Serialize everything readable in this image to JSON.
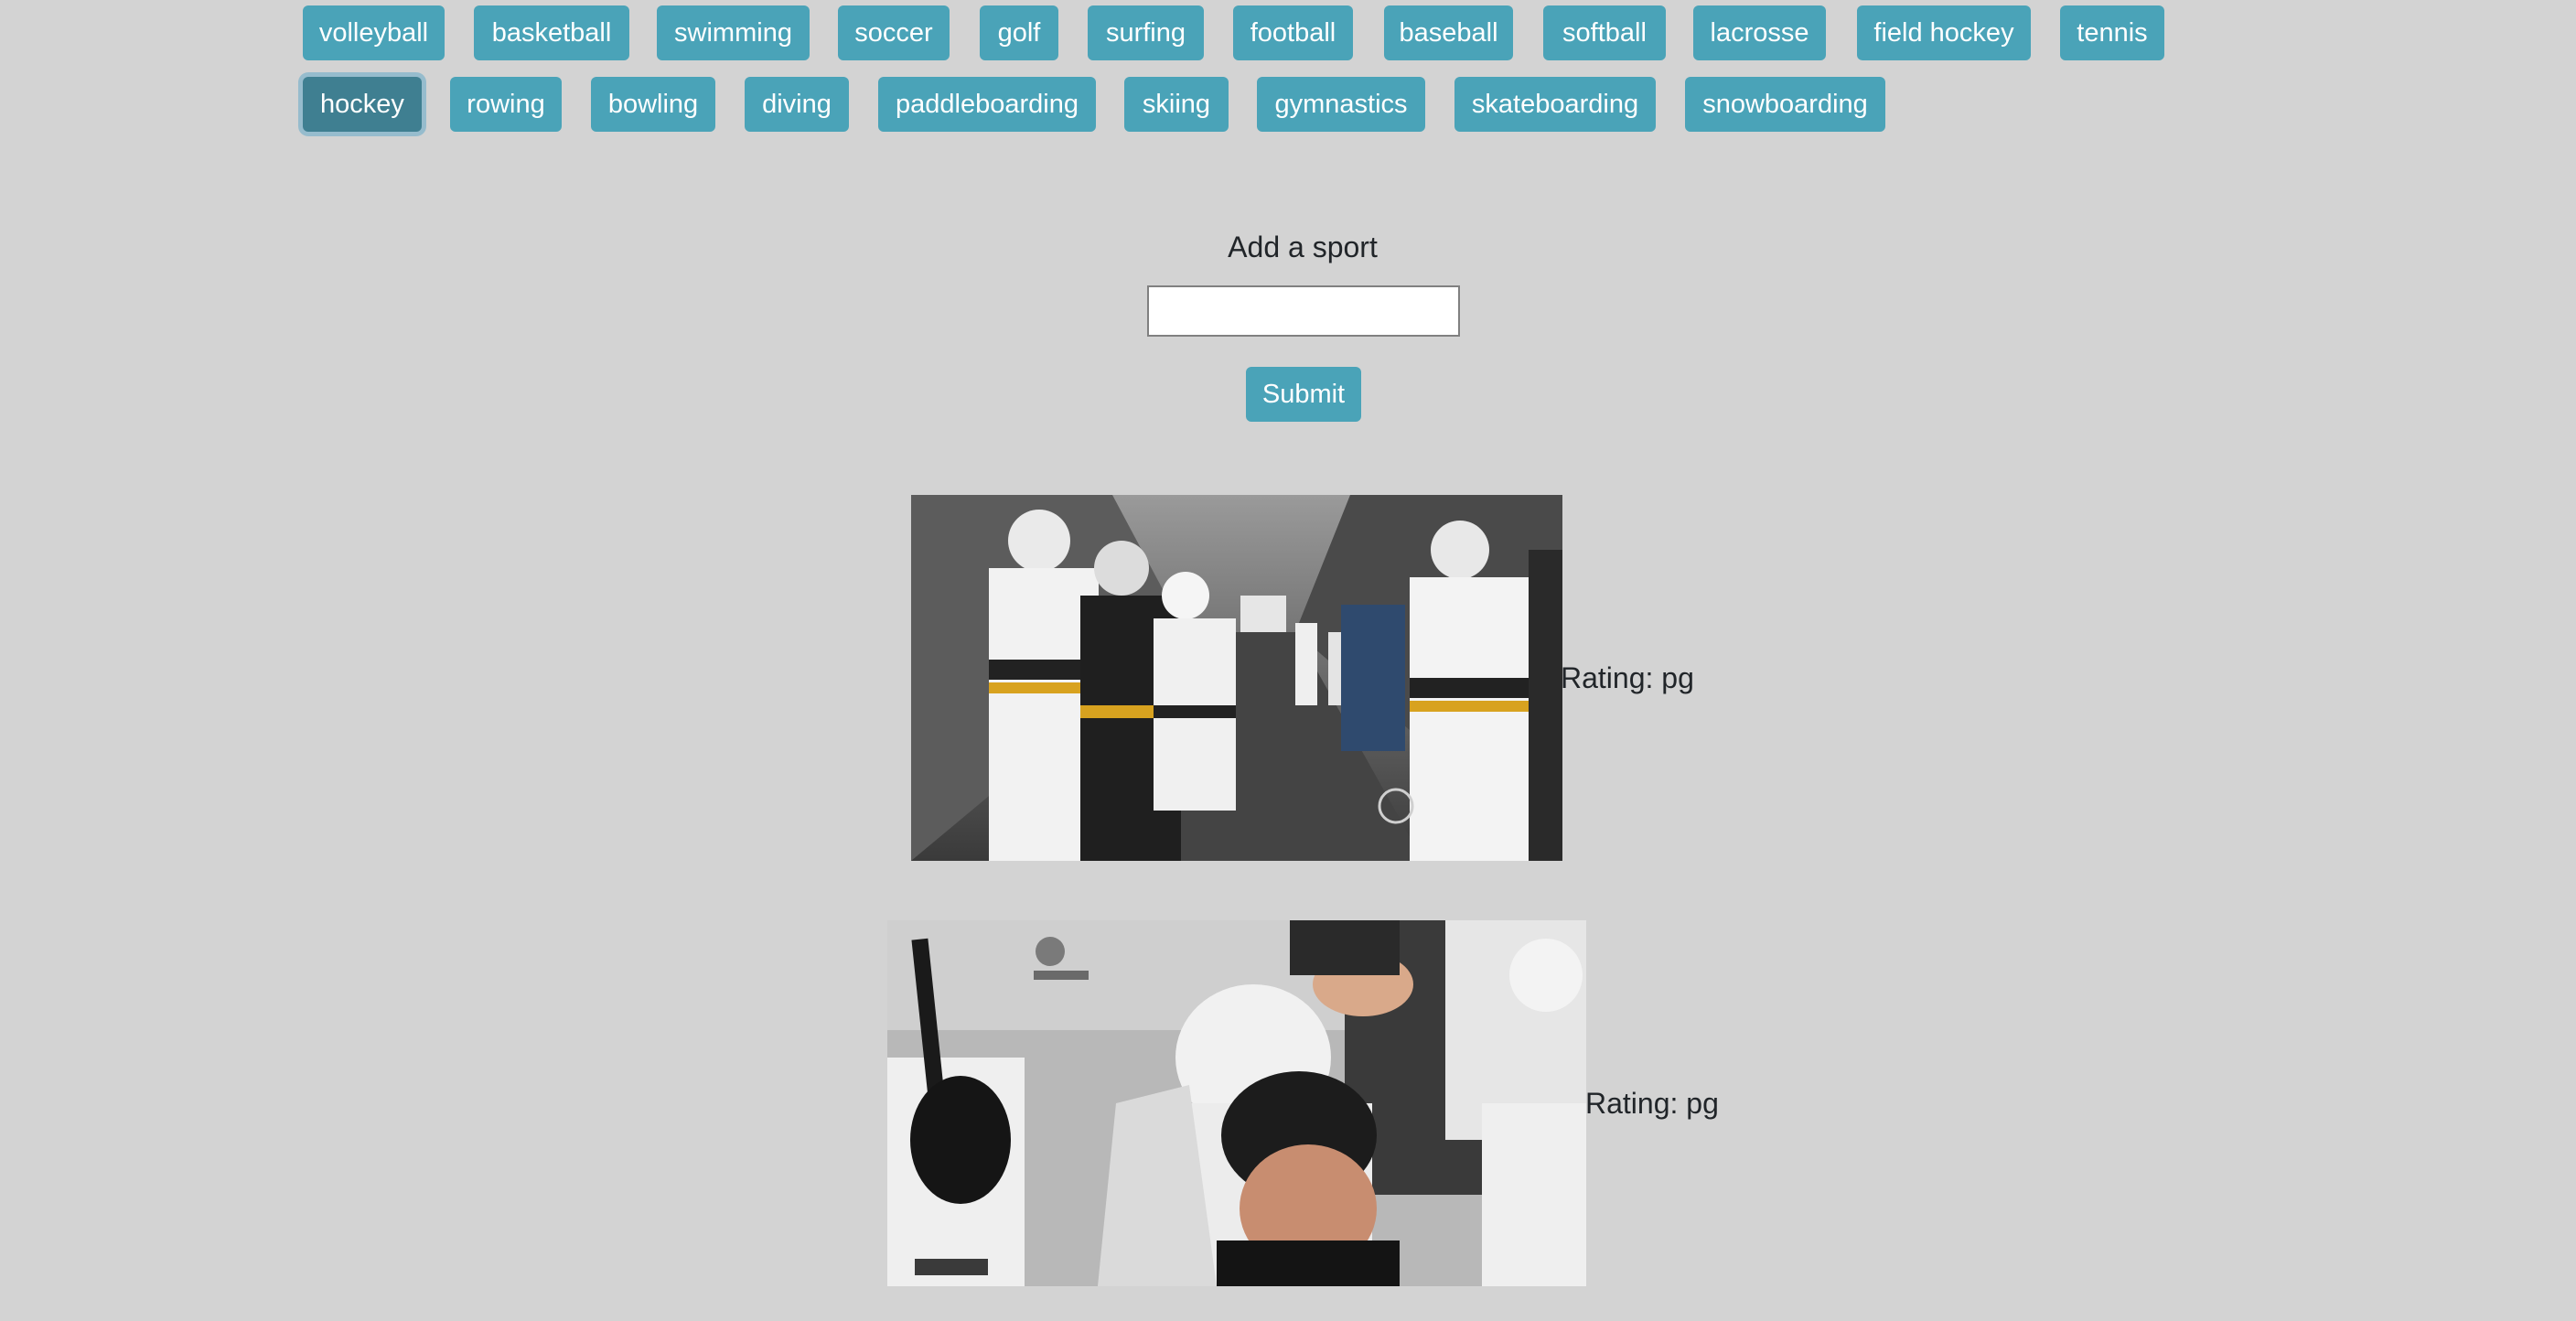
{
  "sports": {
    "row1": [
      "volleyball",
      "basketball",
      "swimming",
      "soccer",
      "golf",
      "surfing",
      "football",
      "baseball",
      "softball",
      "lacrosse",
      "field hockey",
      "tennis"
    ],
    "row2": [
      "hockey",
      "rowing",
      "bowling",
      "diving",
      "paddleboarding",
      "skiing",
      "gymnastics",
      "skateboarding",
      "snowboarding"
    ],
    "active": "hockey"
  },
  "form": {
    "title": "Add a sport",
    "input_value": "",
    "input_placeholder": "",
    "submit_label": "Submit"
  },
  "gifs": [
    {
      "name": "hockey-gif-1",
      "description_icon": "image",
      "rating": "Rating: pg"
    },
    {
      "name": "hockey-gif-2",
      "description_icon": "image",
      "rating": "Rating: pg"
    }
  ],
  "colors": {
    "page_bg": "#d3d3d3",
    "button_bg": "#4aa3b8",
    "button_active_bg": "#3f7f91",
    "button_text": "#ffffff"
  }
}
